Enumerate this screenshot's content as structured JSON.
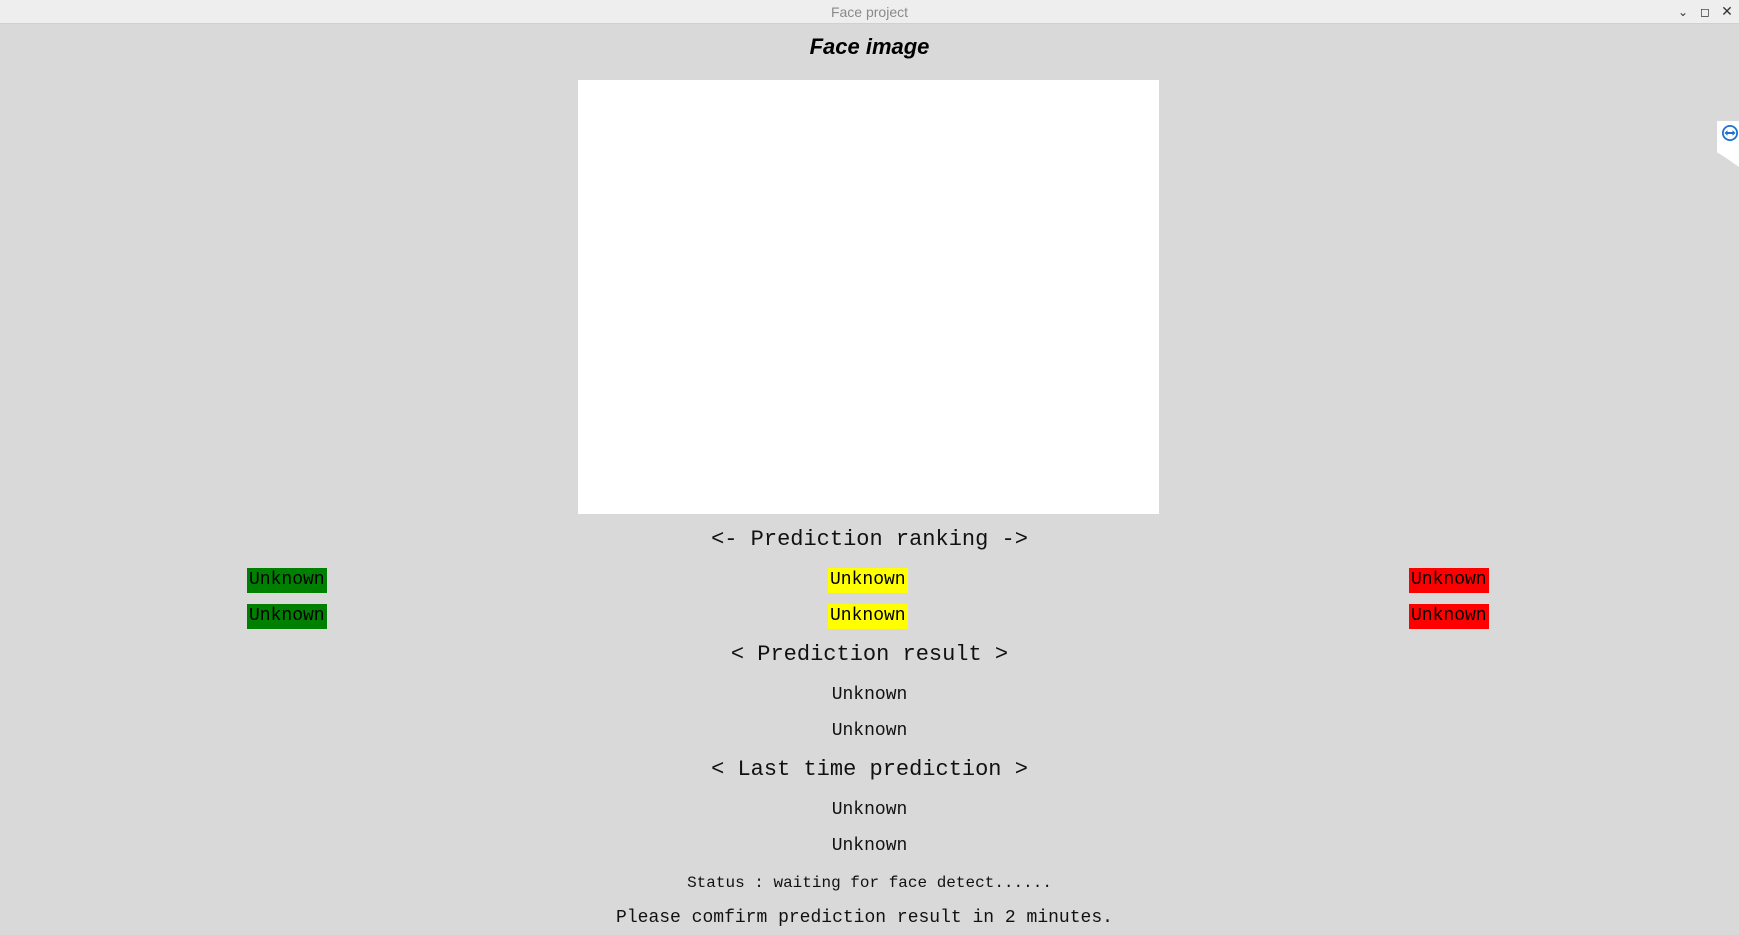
{
  "window": {
    "title": "Face project",
    "controls": {
      "minimize_glyph": "⌄",
      "maximize_glyph": "◻",
      "close_glyph": "✕"
    }
  },
  "heading": "Face image",
  "ranking": {
    "title": "<- Prediction ranking ->",
    "rows": [
      [
        "Unknown",
        "Unknown",
        "Unknown"
      ],
      [
        "Unknown",
        "Unknown",
        "Unknown"
      ]
    ],
    "colors": {
      "left": "#008000",
      "middle": "#ffff00",
      "right": "#ff0000"
    }
  },
  "prediction_result": {
    "title": "< Prediction result >",
    "values": [
      "Unknown",
      "Unknown"
    ]
  },
  "last_prediction": {
    "title": "< Last time prediction >",
    "values": [
      "Unknown",
      "Unknown"
    ]
  },
  "status": "Status : waiting for face detect......",
  "confirm_message": "Please comfirm prediction result in 2 minutes.",
  "icons": {
    "side_tab": "teamviewer-icon"
  }
}
